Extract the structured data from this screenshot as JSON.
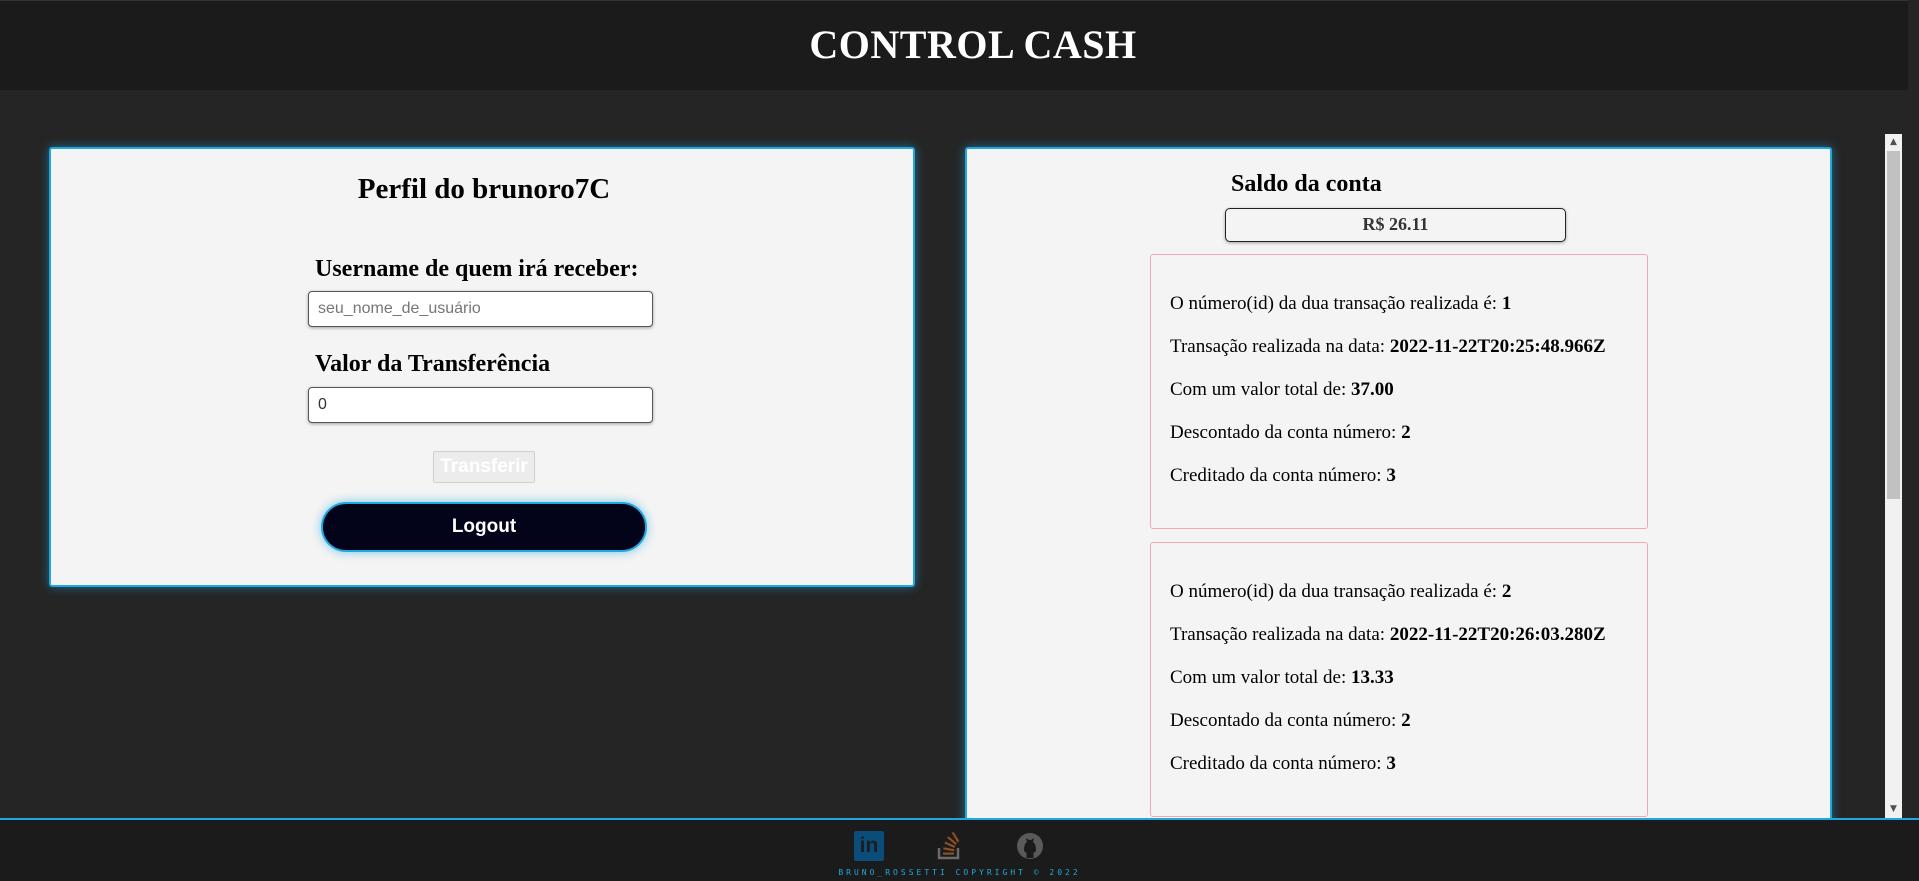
{
  "header": {
    "title": "CONTROL CASH"
  },
  "profile": {
    "title": "Perfil do brunoro7C",
    "receiver_label": "Username de quem irá receber:",
    "receiver_placeholder": "seu_nome_de_usuário",
    "receiver_value": "",
    "amount_label": "Valor da Transferência",
    "amount_value": "0",
    "transfer_button": "Transferir",
    "logout_button": "Logout"
  },
  "account": {
    "balance_title": "Saldo da conta",
    "balance_value": "R$ 26.11",
    "transactions": [
      {
        "id_label": "O número(id) da dua transação realizada é:",
        "id": "1",
        "date_label": "Transação realizada na data:",
        "date": "2022-11-22T20:25:48.966Z",
        "value_label": "Com um valor total de:",
        "value": "37.00",
        "debited_label": "Descontado da conta número:",
        "debited_account": "2",
        "credited_label": "Creditado da conta número:",
        "credited_account": "3"
      },
      {
        "id_label": "O número(id) da dua transação realizada é:",
        "id": "2",
        "date_label": "Transação realizada na data:",
        "date": "2022-11-22T20:26:03.280Z",
        "value_label": "Com um valor total de:",
        "value": "13.33",
        "debited_label": "Descontado da conta número:",
        "debited_account": "2",
        "credited_label": "Creditado da conta número:",
        "credited_account": "3"
      }
    ]
  },
  "footer": {
    "icons": [
      "linkedin-icon",
      "stackoverflow-icon",
      "github-icon"
    ],
    "linkedin_glyph": "in",
    "copyright": "BRUNO_ROSSETTI COPYRIGHT © 2022"
  },
  "colors": {
    "background": "#252525",
    "header": "#1b1b1b",
    "panel": "#f4f4f4",
    "accent": "#1fa8e0",
    "logout_bg": "#030419",
    "card_border": "#f0a9b4"
  }
}
